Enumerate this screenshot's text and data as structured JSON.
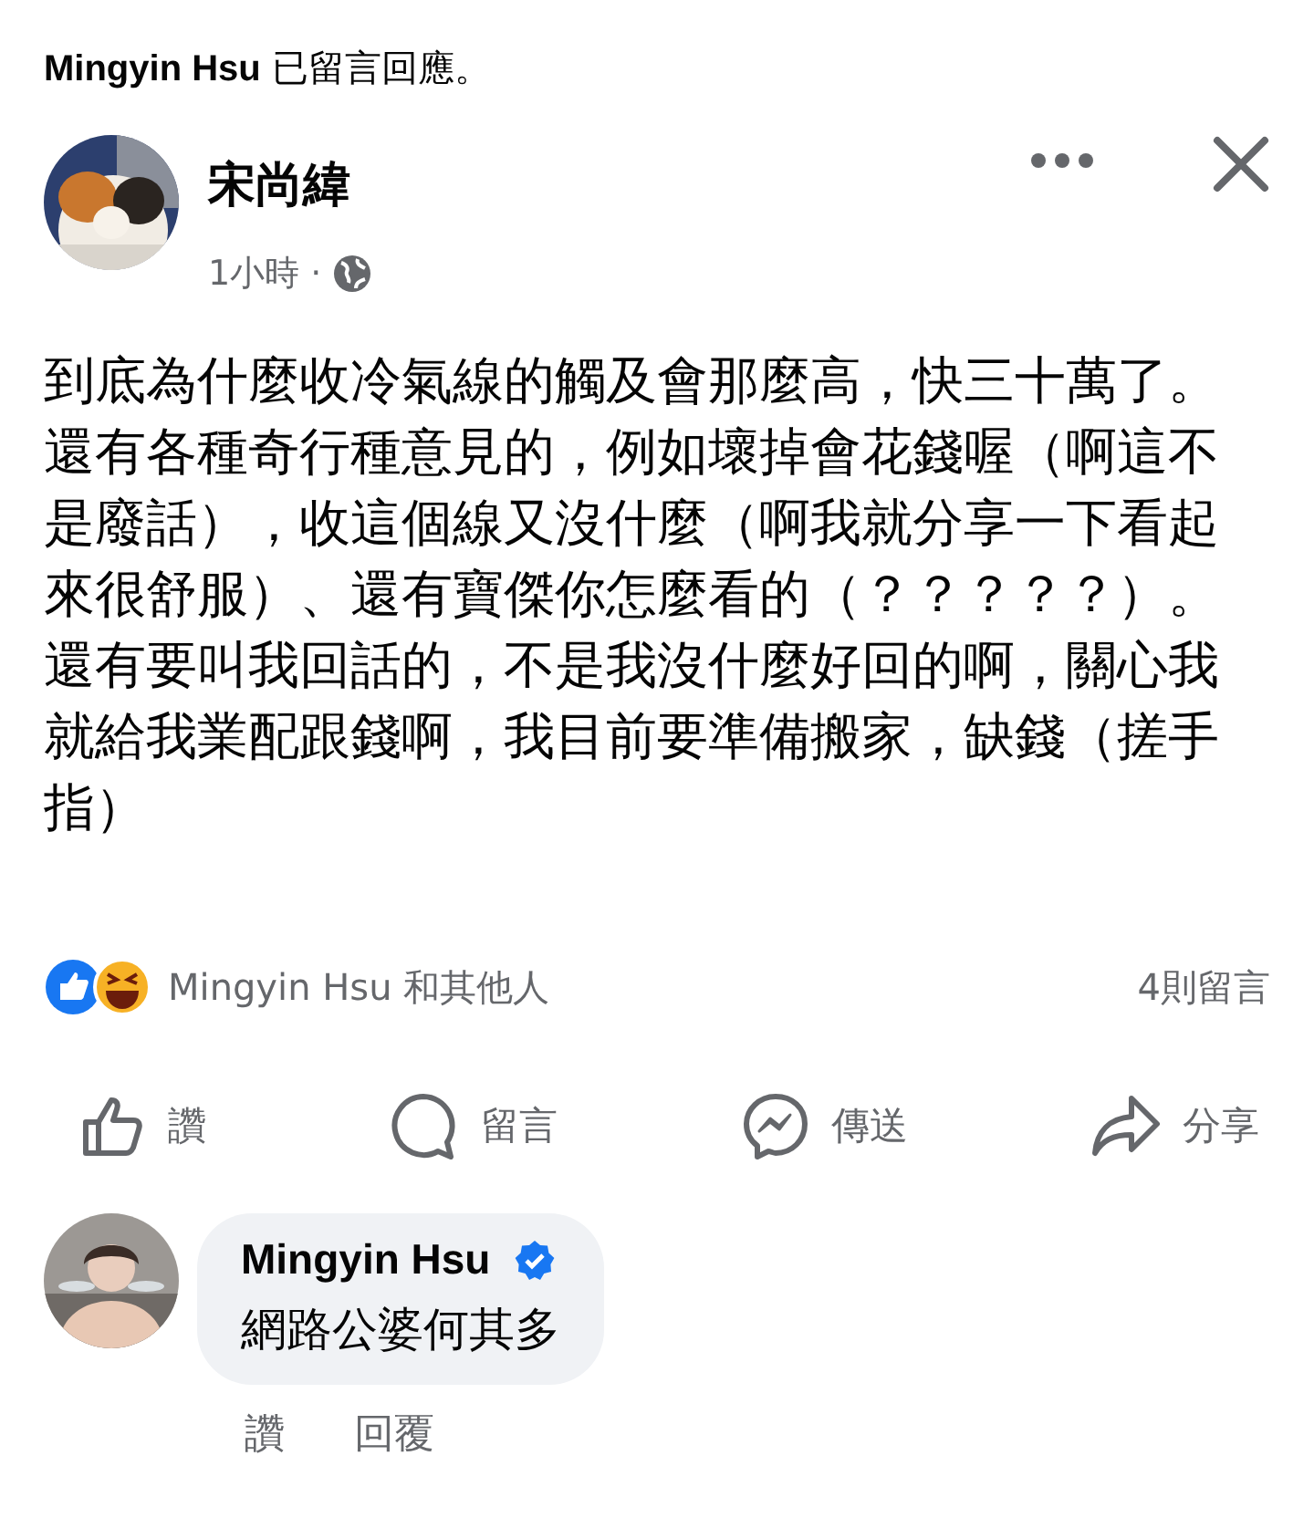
{
  "notice": "**Mingyin Hsu** 已留言回應。",
  "post": {
    "author": "宋尚緯",
    "time": "1小時 ·",
    "body": "到底為什麼收冷氣線的觸及會那麼高，快三十萬了。還有各種奇行種意見的，例如壞掉會花錢喔（啊這不是廢話），收這個線又沒什麼（啊我就分享一下看起來很舒服）、還有寶傑你怎麼看的（？？？？？）。還有要叫我回話的，不是我沒什麼好回的啊，關心我就給我業配跟錢啊，我目前要準備搬家，缺錢（搓手指）"
  },
  "reactions": {
    "summary": "Mingyin Hsu 和其他人",
    "comments_count": "4則留言"
  },
  "actions": [
    {
      "kind": "like",
      "label": "讚"
    },
    {
      "kind": "comment",
      "label": "留言"
    },
    {
      "kind": "send",
      "label": "傳送"
    },
    {
      "kind": "share",
      "label": "分享"
    }
  ],
  "comment": {
    "author": "Mingyin Hsu",
    "verified": true,
    "text": "網路公婆何其多",
    "actions": [
      "讚",
      "回覆"
    ]
  }
}
